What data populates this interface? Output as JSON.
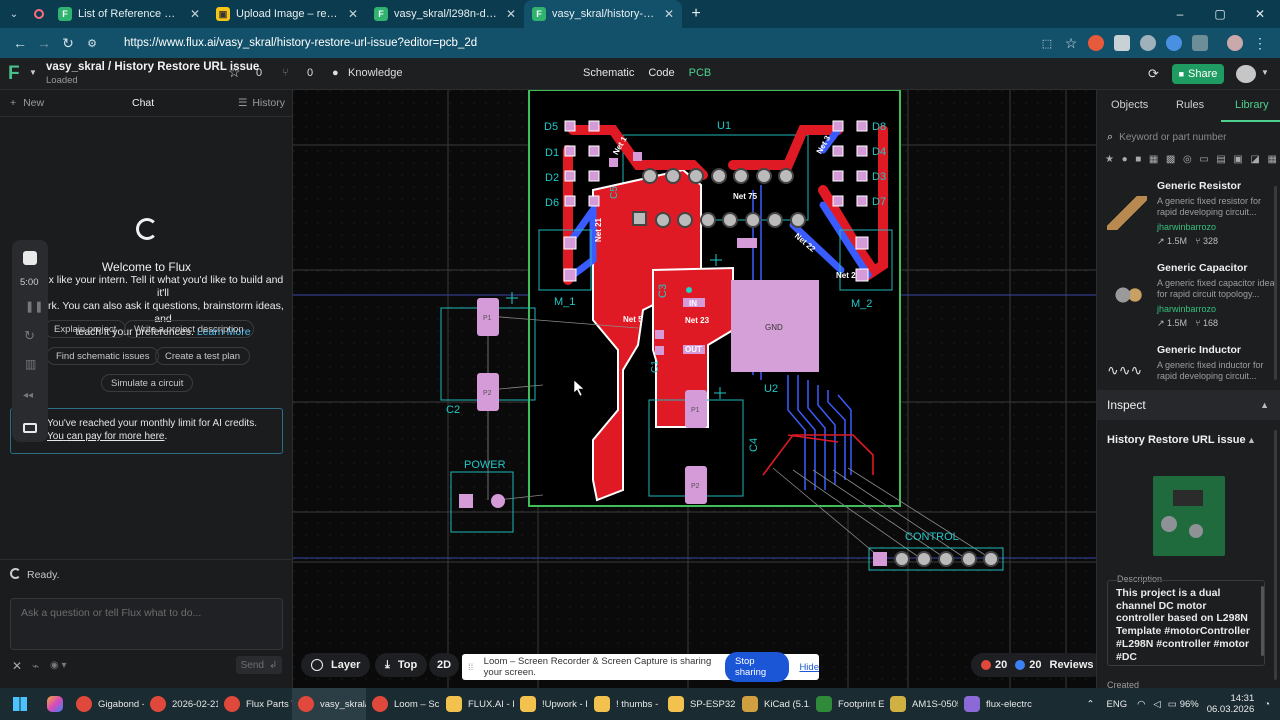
{
  "browser": {
    "tabs": [
      {
        "title": "List of Reference Design(vasy_s",
        "icon": "flux-icon",
        "color": "#2fb36f"
      },
      {
        "title": "Upload Image – remove.bg",
        "icon": "removebg-icon",
        "color": "#f5c518"
      },
      {
        "title": "vasy_skral/l298n-dual-h-bridge",
        "icon": "flux-icon",
        "color": "#2fb36f"
      },
      {
        "title": "vasy_skral/history-restore-url-is",
        "icon": "flux-icon",
        "color": "#2fb36f"
      }
    ],
    "url": "https://www.flux.ai/vasy_skral/history-restore-url-issue?editor=pcb_2d"
  },
  "app": {
    "project_title": "vasy_skral / History Restore URL issue",
    "status": "Loaded",
    "star_count": "0",
    "fork_count": "0",
    "knowledge": "Knowledge",
    "modes": [
      "Schematic",
      "Code",
      "PCB"
    ],
    "active_mode": "PCB",
    "share": "Share",
    "accent": "#1e9c62"
  },
  "chat": {
    "new": "New",
    "chat": "Chat",
    "history": "History",
    "welcome_title": "Welcome to Flux",
    "welcome_line1": "ux like your intern. Tell it what you'd like to build and it'll",
    "welcome_line2": "ork. You can also ask it questions, brainstorm ideas, and",
    "welcome_line3": "teach it your preferences.",
    "learn_more": "Learn More",
    "chips": [
      "Explain project",
      "Write a project description",
      "Find schematic issues",
      "Create a test plan",
      "Simulate a circuit"
    ],
    "limit_line1": "You've reached your monthly limit for AI credits.",
    "limit_link1": "You",
    "limit_link2": "can pay for more here",
    "ready": "Ready.",
    "placeholder": "Ask a question or tell Flux what to do...",
    "send": "Send",
    "loom_timer": "5:00"
  },
  "pcb": {
    "labels": [
      "D5",
      "D1",
      "D2",
      "D6",
      "U1",
      "D8",
      "D4",
      "D3",
      "D7",
      "M_1",
      "M_2",
      "C5",
      "C3",
      "C1",
      "C2",
      "C4",
      "U2",
      "POWER",
      "CONTROL",
      "GND"
    ],
    "nets": [
      "Net 1",
      "Net 3",
      "Net 75",
      "Net 21",
      "Net 22",
      "Net 23",
      "Net 5",
      "Net 2",
      "IN",
      "OUT"
    ],
    "pads_numbers": [
      "P1",
      "P2",
      "P1",
      "P2",
      "P1",
      "P2"
    ]
  },
  "bottom": {
    "layer": "Layer",
    "top": "Top",
    "view2d": "2D",
    "errors": "20",
    "warnings": "20",
    "reviews": "Reviews"
  },
  "loom": {
    "message": "Loom – Screen Recorder & Screen Capture is sharing your screen.",
    "stop": "Stop sharing",
    "hide": "Hide"
  },
  "library": {
    "tabs": [
      "Objects",
      "Rules",
      "Library"
    ],
    "active_tab": "Library",
    "search_placeholder": "Keyword or part number",
    "items": [
      {
        "name": "Generic Resistor",
        "desc": "A generic fixed resistor for rapid developing circuit...",
        "author": "jharwinbarrozo",
        "stars": "1.5M",
        "forks": "328"
      },
      {
        "name": "Generic Capacitor",
        "desc": "A generic fixed capacitor ideal for rapid circuit topology...",
        "author": "jharwinbarrozo",
        "stars": "1.5M",
        "forks": "168"
      },
      {
        "name": "Generic Inductor",
        "desc": "A generic fixed inductor for rapid developing circuit...",
        "author": "",
        "stars": "",
        "forks": ""
      }
    ]
  },
  "inspect": {
    "title": "Inspect",
    "project": "History Restore URL issue",
    "desc_label": "Description",
    "description": "This project is a dual channel DC motor controller  based on L298N Template #motorController #L298N #controller #motor #DC",
    "created": "Created"
  },
  "taskbar": {
    "apps": [
      {
        "label": "Gigabond -",
        "color": "#e0483c"
      },
      {
        "label": "2026-02-21",
        "color": "#e0483c"
      },
      {
        "label": "Flux Parts T",
        "color": "#e0483c"
      },
      {
        "label": "vasy_skral/l",
        "color": "#e0483c"
      },
      {
        "label": "Loom – Scr",
        "color": "#e0483c"
      },
      {
        "label": "FLUX.AI - F",
        "color": "#f2c14e"
      },
      {
        "label": "!Upwork - I",
        "color": "#f2c14e"
      },
      {
        "label": "! thumbs -",
        "color": "#f2c14e"
      },
      {
        "label": "SP-ESP32S:",
        "color": "#f2c14e"
      },
      {
        "label": "KiCad (5.1.1",
        "color": "#d0a040"
      },
      {
        "label": "Footprint E",
        "color": "#2f8a3a"
      },
      {
        "label": "AM1S-0505",
        "color": "#d0b040"
      },
      {
        "label": "flux-electrc",
        "color": "#8b6ad8"
      }
    ],
    "lang": "ENG",
    "battery": "96%",
    "time": "14:31",
    "date": "06.03.2026"
  }
}
